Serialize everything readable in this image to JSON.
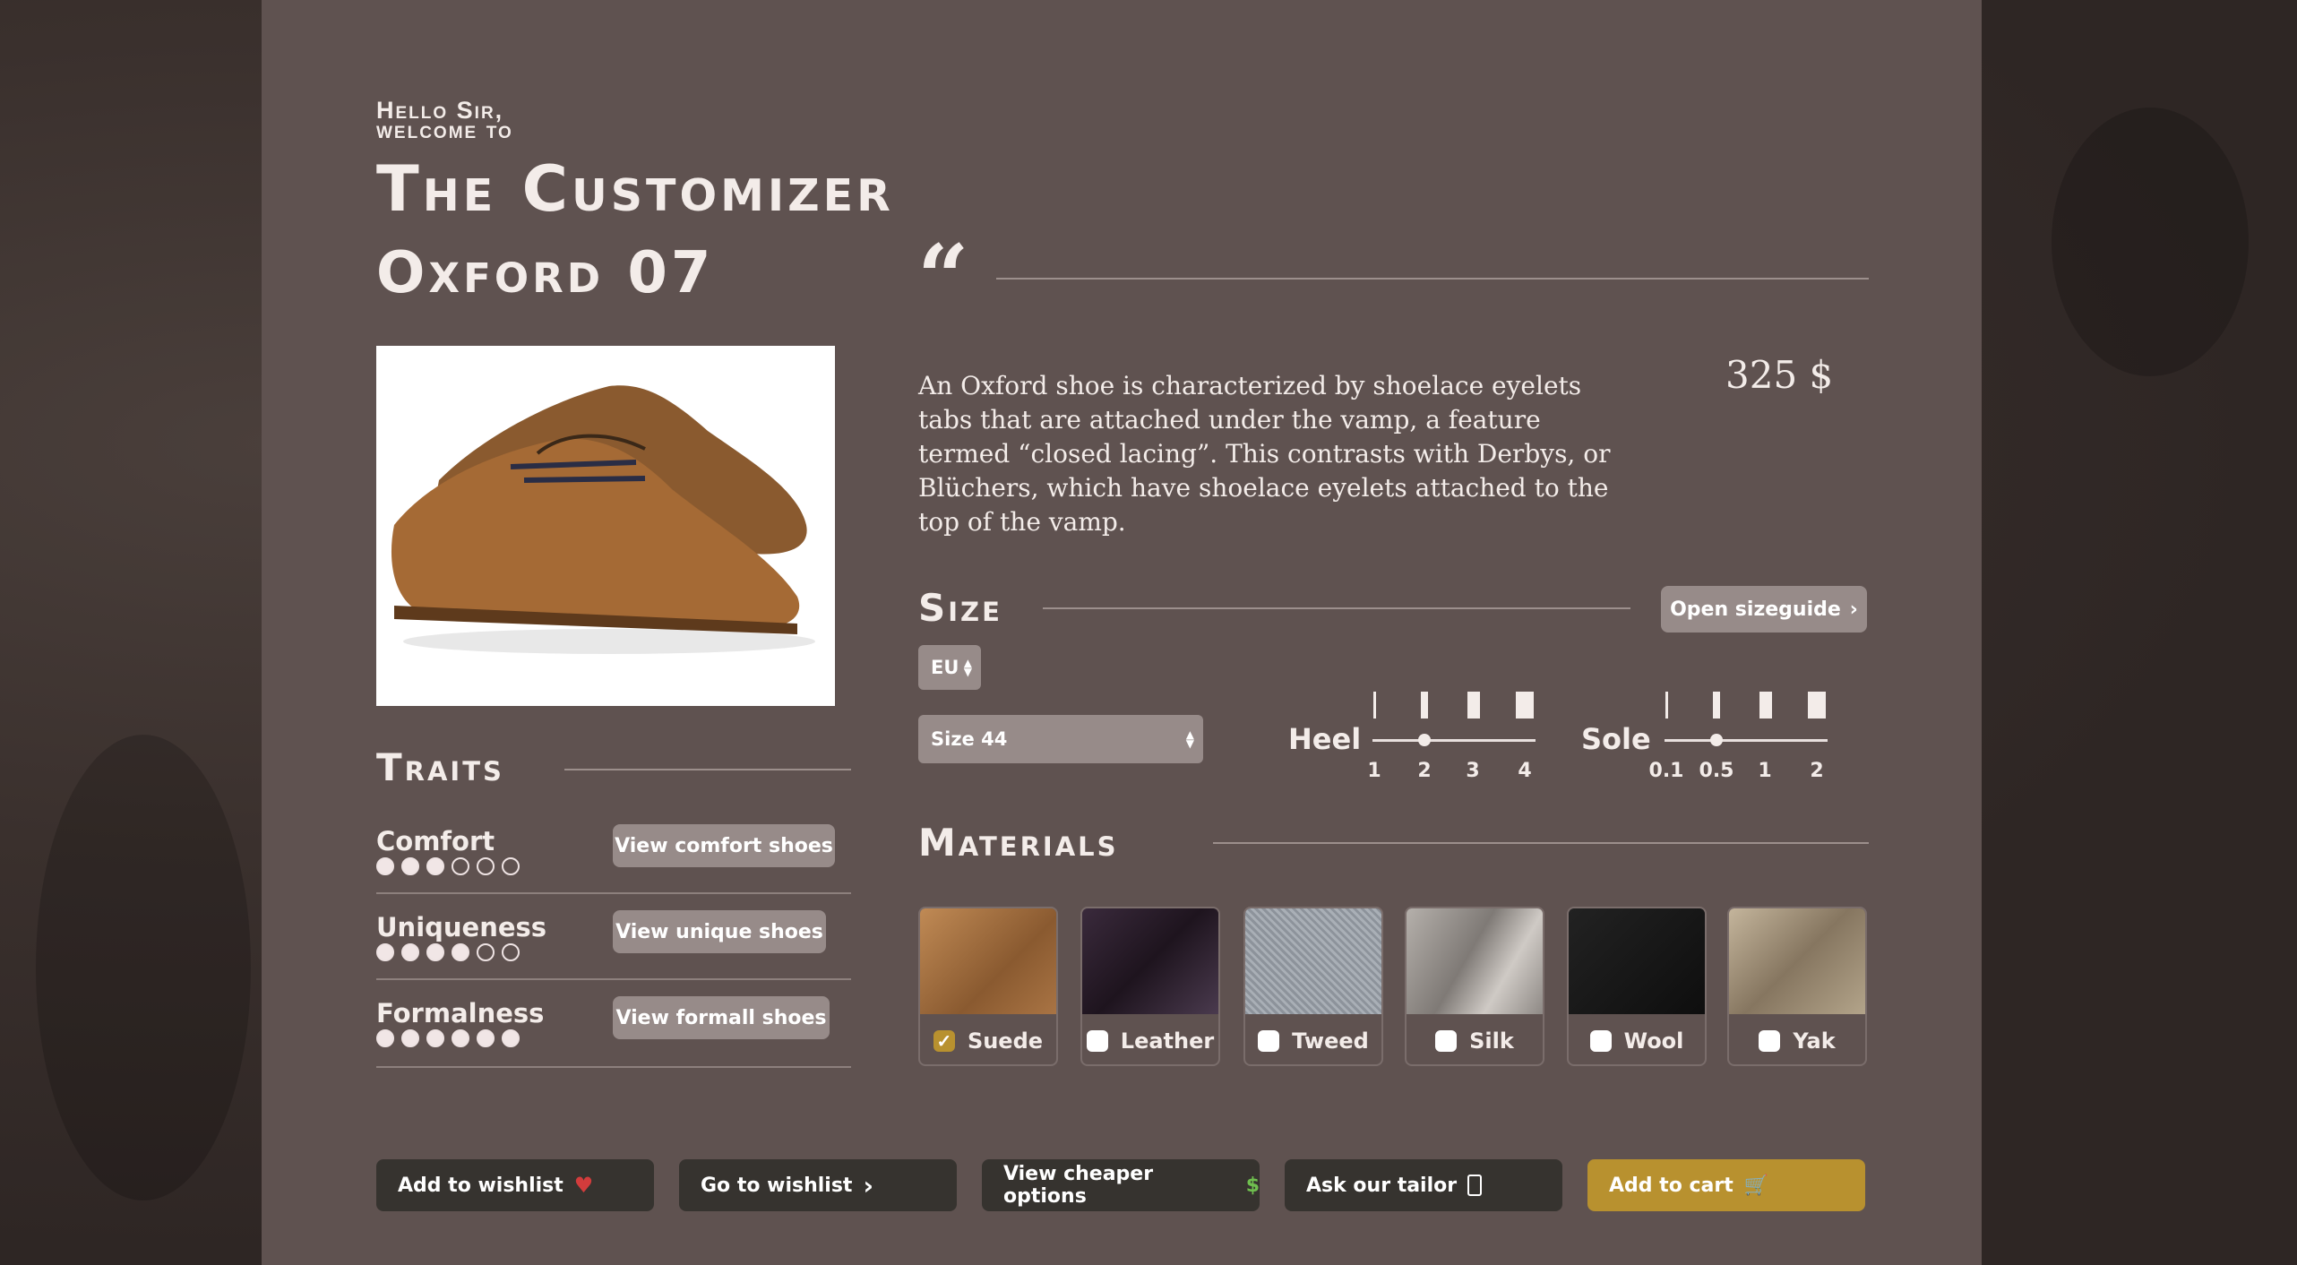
{
  "header": {
    "greeting_line1": "Hello Sir,",
    "greeting_line2": "welcome to",
    "title": "The Customizer"
  },
  "product": {
    "model": "Oxford 07",
    "description": "An Oxford shoe is characterized by shoelace eyelets tabs that are attached under the vamp, a feature termed “closed lacing”. This contrasts with Derbys, or Blüchers, which have shoelace eyelets attached to the top of the vamp.",
    "price": "325 $"
  },
  "traits": {
    "heading": "Traits",
    "items": [
      {
        "name": "Comfort",
        "rating": 3,
        "max": 6,
        "button": "View comfort shoes"
      },
      {
        "name": "Uniqueness",
        "rating": 4,
        "max": 6,
        "button": "View unique shoes"
      },
      {
        "name": "Formalness",
        "rating": 6,
        "max": 6,
        "button": "View formall shoes"
      }
    ]
  },
  "size": {
    "heading": "Size",
    "sizeguide_button": "Open sizeguide",
    "unit_select": "EU",
    "size_select": "Size 44",
    "heel": {
      "label": "Heel",
      "ticks": [
        "1",
        "2",
        "3",
        "4"
      ],
      "selected_index": 1
    },
    "sole": {
      "label": "Sole",
      "ticks": [
        "0.1",
        "0.5",
        "1",
        "2"
      ],
      "selected_index": 1
    }
  },
  "materials": {
    "heading": "Materials",
    "items": [
      {
        "name": "Suede",
        "checked": true,
        "color": "#a06c3e"
      },
      {
        "name": "Leather",
        "checked": false,
        "color": "#2c1f2c"
      },
      {
        "name": "Tweed",
        "checked": false,
        "color": "#8f949b"
      },
      {
        "name": "Silk",
        "checked": false,
        "color": "#9e9a97"
      },
      {
        "name": "Wool",
        "checked": false,
        "color": "#151515"
      },
      {
        "name": "Yak",
        "checked": false,
        "color": "#a8987f"
      }
    ]
  },
  "actions": {
    "add_wishlist": "Add to wishlist",
    "go_wishlist": "Go to wishlist",
    "cheaper": "View cheaper options",
    "tailor": "Ask our tailor",
    "cart": "Add to cart"
  },
  "colors": {
    "panel": "#5f5250",
    "accent": "#b8912f",
    "dark_button": "#36332f"
  }
}
